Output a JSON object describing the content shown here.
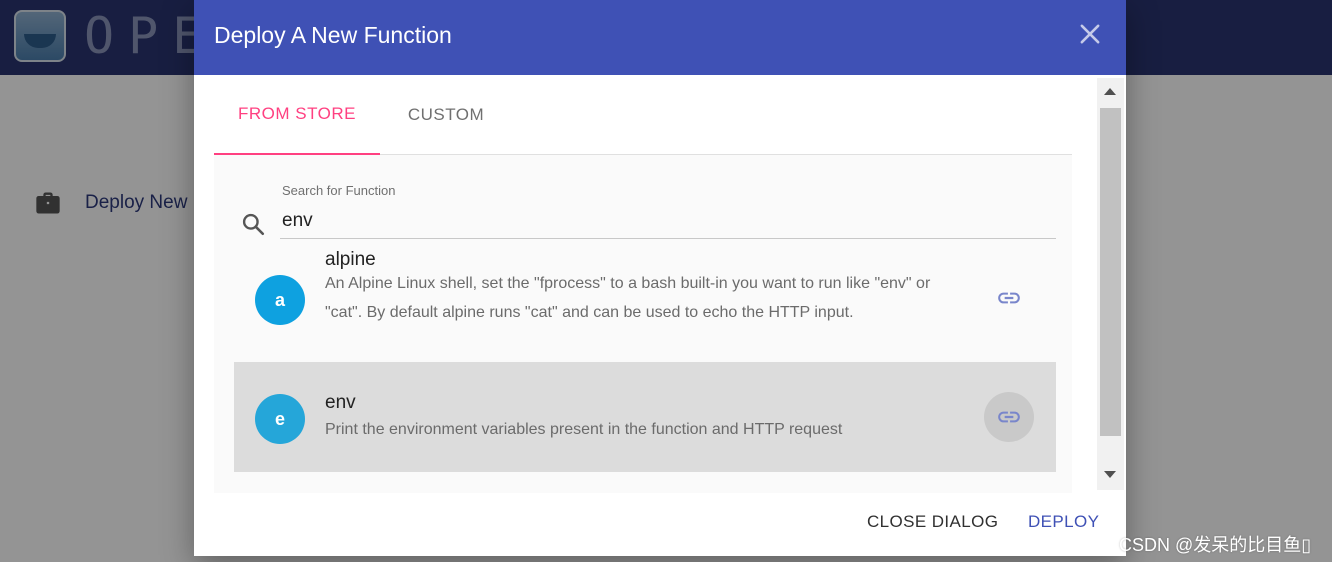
{
  "app": {
    "brand": "OPE",
    "sidebar": {
      "items": [
        {
          "label": "Deploy New",
          "icon": "briefcase-icon"
        }
      ]
    }
  },
  "dialog": {
    "title": "Deploy A New Function",
    "tabs": [
      {
        "label": "FROM STORE",
        "active": true
      },
      {
        "label": "CUSTOM",
        "active": false
      }
    ],
    "search": {
      "label": "Search for Function",
      "value": "env"
    },
    "results": [
      {
        "avatar_letter": "a",
        "name": "alpine",
        "description": "An Alpine Linux shell, set the \"fprocess\" to a bash built-in you want to run like \"env\" or \"cat\". By default alpine runs \"cat\" and can be used to echo the HTTP input.",
        "icon": "link-icon"
      },
      {
        "avatar_letter": "e",
        "name": "env",
        "description": "Print the environment variables present in the function and HTTP request",
        "icon": "link-icon",
        "selected": true
      }
    ],
    "actions": {
      "close_label": "CLOSE DIALOG",
      "deploy_label": "DEPLOY"
    }
  },
  "colors": {
    "header": "#3f51b5",
    "accent_tab": "#ff4081",
    "deploy": "#3f51b5"
  },
  "watermark": "CSDN @发呆的比目鱼▯"
}
